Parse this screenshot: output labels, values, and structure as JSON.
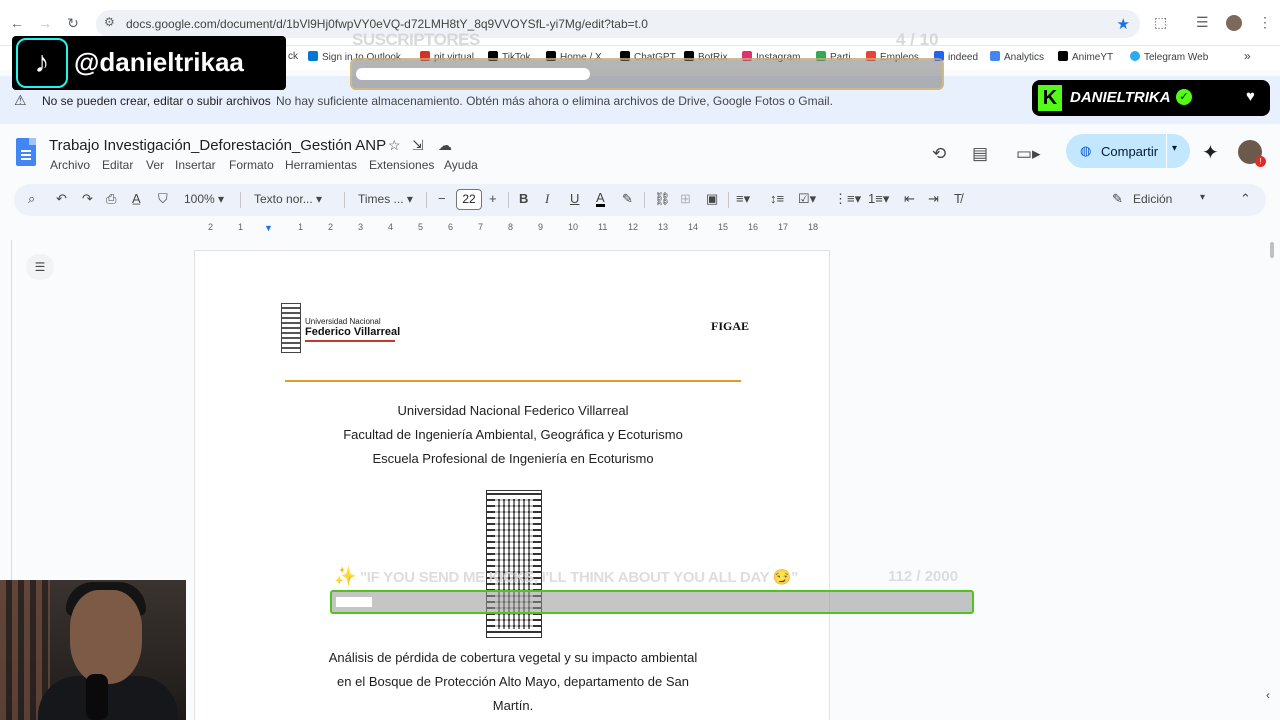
{
  "browser": {
    "url": "docs.google.com/document/d/1bVl9Hj0fwpVY0eVQ-d72LMH8tY_8q9VVOYSfL-yi7Mg/edit?tab=t.0"
  },
  "bookmarks": [
    {
      "label": "ck",
      "color": "#ffffff"
    },
    {
      "label": "Sign in to Outlook",
      "color": "#0078d4"
    },
    {
      "label": "pit virtual",
      "color": "#d93025"
    },
    {
      "label": "TikTok",
      "color": "#000000"
    },
    {
      "label": "Home / X",
      "color": "#000000"
    },
    {
      "label": "ChatGPT",
      "color": "#000000"
    },
    {
      "label": "BotRix",
      "color": "#000000"
    },
    {
      "label": "Instagram",
      "color": "#e1306c"
    },
    {
      "label": "Parti",
      "color": "#34a853"
    },
    {
      "label": "Empleos",
      "color": "#ea4335"
    },
    {
      "label": "indeed",
      "color": "#2164f3"
    },
    {
      "label": "Analytics",
      "color": "#4285f4"
    },
    {
      "label": "AnimeYT",
      "color": "#000000"
    },
    {
      "label": "Telegram Web",
      "color": "#2aabee"
    }
  ],
  "warning": {
    "title": "No se pueden crear, editar o subir archivos",
    "message": "No hay suficiente almacenamiento. Obtén más ahora o elimina archivos de Drive, Google Fotos o Gmail."
  },
  "doc": {
    "title": "Trabajo Investigación_Deforestación_Gestión ANP",
    "menu": [
      "Archivo",
      "Editar",
      "Ver",
      "Insertar",
      "Formato",
      "Herramientas",
      "Extensiones",
      "Ayuda"
    ],
    "share_label": "Compartir"
  },
  "toolbar": {
    "zoom": "100%",
    "style": "Texto nor...",
    "font": "Times ...",
    "font_size": "22",
    "mode": "Edición"
  },
  "ruler": [
    "2",
    "1",
    "1",
    "2",
    "3",
    "4",
    "5",
    "6",
    "7",
    "8",
    "9",
    "10",
    "11",
    "12",
    "13",
    "14",
    "15",
    "16",
    "17",
    "18"
  ],
  "page": {
    "logo_small": "Universidad Nacional",
    "logo_big": "Federico Villarreal",
    "figae": "FIGAE",
    "heading": [
      "Universidad Nacional Federico Villarreal",
      "Facultad de Ingeniería Ambiental, Geográfica y Ecoturismo",
      "Escuela Profesional de Ingeniería en Ecoturismo"
    ],
    "subtitle": [
      "Análisis de pérdida de cobertura vegetal y su impacto ambiental",
      "en el Bosque de Protección Alto Mayo, departamento de San",
      "Martín."
    ]
  },
  "overlays": {
    "tiktok_handle": "@danieltrikaa",
    "sub_goal_label": "SUSCRIPTORES",
    "sub_goal_count": "4  / 10",
    "sub_goal_progress": 0.4,
    "kick_name": "DANIELTRIKA",
    "kick_goal_message": "\"IF YOU SEND ME KICKS, I'LL THINK ABOUT YOU ALL DAY 😏\"",
    "kick_goal_count": "112  / 2000",
    "kick_goal_progress": 0.056
  },
  "colors": {
    "accent": "#1a73e8",
    "kick_green": "#53fc18",
    "rule_orange": "#e69a2a"
  }
}
